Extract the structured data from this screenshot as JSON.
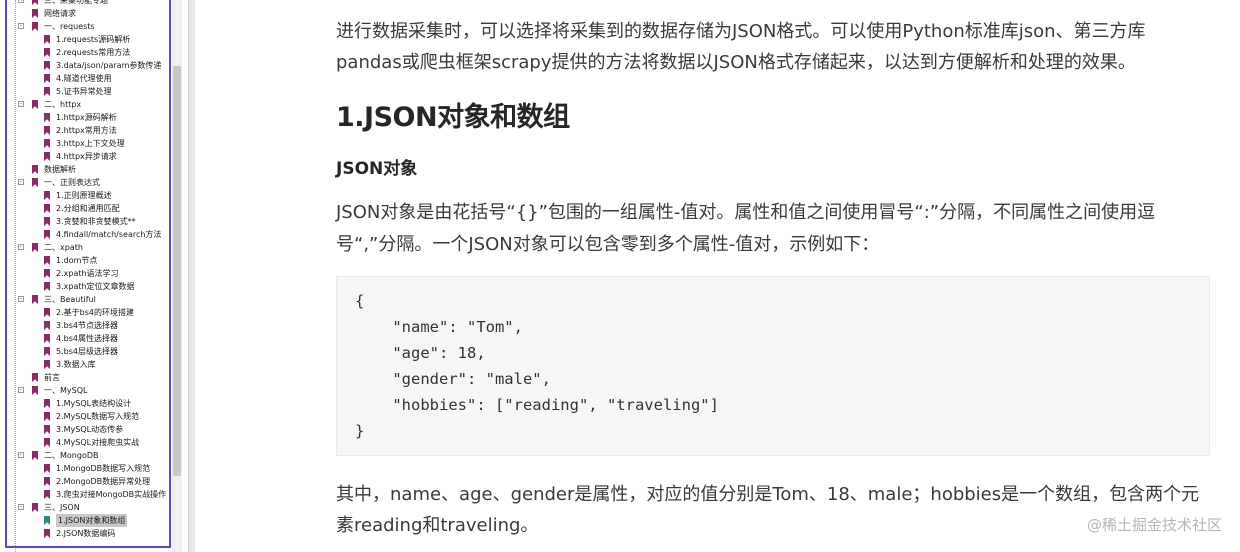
{
  "tree": {
    "items": [
      {
        "label": "三、采集功能专题",
        "level": 0,
        "expander": "+",
        "icon": "purple"
      },
      {
        "label": "网络请求",
        "level": 0,
        "expander": "",
        "icon": "purple"
      },
      {
        "label": "一、requests",
        "level": 0,
        "expander": "-",
        "icon": "purple"
      },
      {
        "label": "1.requests源码解析",
        "level": 1,
        "icon": "purple"
      },
      {
        "label": "2.requests常用方法",
        "level": 1,
        "icon": "purple"
      },
      {
        "label": "3.data/json/param参数传递",
        "level": 1,
        "icon": "purple"
      },
      {
        "label": "4.隧道代理使用",
        "level": 1,
        "icon": "purple"
      },
      {
        "label": "5.证书异常处理",
        "level": 1,
        "icon": "purple"
      },
      {
        "label": "二、httpx",
        "level": 0,
        "expander": "-",
        "icon": "purple"
      },
      {
        "label": "1.httpx源码解析",
        "level": 1,
        "icon": "purple"
      },
      {
        "label": "2.httpx常用方法",
        "level": 1,
        "icon": "purple"
      },
      {
        "label": "3.httpx上下文处理",
        "level": 1,
        "icon": "purple"
      },
      {
        "label": "4.httpx异步请求",
        "level": 1,
        "icon": "purple"
      },
      {
        "label": "数据解析",
        "level": 0,
        "expander": "",
        "icon": "purple"
      },
      {
        "label": "一、正则表达式",
        "level": 0,
        "expander": "-",
        "icon": "purple"
      },
      {
        "label": "1.正则原理概述",
        "level": 1,
        "icon": "purple"
      },
      {
        "label": "2.分组和通用匹配",
        "level": 1,
        "icon": "purple"
      },
      {
        "label": "3.贪婪和非贪婪模式**",
        "level": 1,
        "icon": "purple"
      },
      {
        "label": "4.findall/match/search方法",
        "level": 1,
        "icon": "purple"
      },
      {
        "label": "二、xpath",
        "level": 0,
        "expander": "-",
        "icon": "purple"
      },
      {
        "label": "1.dom节点",
        "level": 1,
        "icon": "purple"
      },
      {
        "label": "2.xpath语法学习",
        "level": 1,
        "icon": "purple"
      },
      {
        "label": "3.xpath定位文章数据",
        "level": 1,
        "icon": "purple"
      },
      {
        "label": "三、Beautiful",
        "level": 0,
        "expander": "-",
        "icon": "purple"
      },
      {
        "label": "2.基于bs4的环境搭建",
        "level": 1,
        "icon": "purple"
      },
      {
        "label": "3.bs4节点选择器",
        "level": 1,
        "icon": "purple"
      },
      {
        "label": "4.bs4属性选择器",
        "level": 1,
        "icon": "purple"
      },
      {
        "label": "5.bs4层级选择器",
        "level": 1,
        "icon": "purple"
      },
      {
        "label": "3.数据入库",
        "level": 1,
        "icon": "purple"
      },
      {
        "label": "前言",
        "level": 0,
        "expander": "",
        "icon": "purple"
      },
      {
        "label": "一、MySQL",
        "level": 0,
        "expander": "-",
        "icon": "purple"
      },
      {
        "label": "1.MySQL表结构设计",
        "level": 1,
        "icon": "purple"
      },
      {
        "label": "2.MySQL数据写入规范",
        "level": 1,
        "icon": "purple"
      },
      {
        "label": "3.MySQL动态传参",
        "level": 1,
        "icon": "purple"
      },
      {
        "label": "4.MySQL对接爬虫实战",
        "level": 1,
        "icon": "purple"
      },
      {
        "label": "二、MongoDB",
        "level": 0,
        "expander": "-",
        "icon": "purple"
      },
      {
        "label": "1.MongoDB数据写入规范",
        "level": 1,
        "icon": "purple"
      },
      {
        "label": "2.MongoDB数据异常处理",
        "level": 1,
        "icon": "purple"
      },
      {
        "label": "3.爬虫对接MongoDB实战操作",
        "level": 1,
        "icon": "purple"
      },
      {
        "label": "三、JSON",
        "level": 0,
        "expander": "-",
        "icon": "purple"
      },
      {
        "label": "1.JSON对象和数组",
        "level": 1,
        "icon": "teal",
        "selected": true
      },
      {
        "label": "2.JSON数据编码",
        "level": 1,
        "icon": "purple"
      }
    ]
  },
  "article": {
    "intro": "进行数据采集时，可以选择将采集到的数据存储为JSON格式。可以使用Python标准库json、第三方库pandas或爬虫框架scrapy提供的方法将数据以JSON格式存储起来，以达到方便解析和处理的效果。",
    "heading": "1.JSON对象和数组",
    "subheading": "JSON对象",
    "description": "JSON对象是由花括号“{}”包围的一组属性-值对。属性和值之间使用冒号“:”分隔，不同属性之间使用逗号“,”分隔。一个JSON对象可以包含零到多个属性-值对，示例如下：",
    "code_lines": [
      "{",
      "    \"name\": \"Tom\",",
      "    \"age\": 18,",
      "    \"gender\": \"male\",",
      "    \"hobbies\": [\"reading\", \"traveling\"]",
      "}"
    ],
    "conclusion": "其中，name、age、gender是属性，对应的值分别是Tom、18、male；hobbies是一个数组，包含两个元素reading和traveling。"
  },
  "watermark": "@稀土掘金技术社区",
  "colors": {
    "panel_border": "#5b47c8",
    "bookmark": "#8b2a66",
    "bookmark_selected": "#2a8b82",
    "code_bg": "#f6f6f6"
  }
}
